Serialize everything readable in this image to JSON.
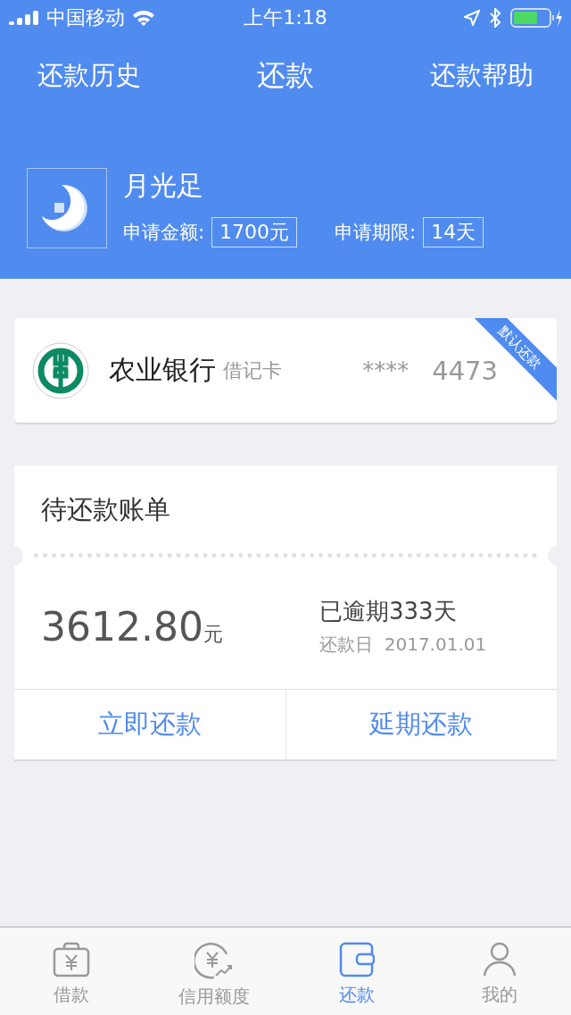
{
  "status_bar": {
    "carrier": "中国移动",
    "time": "上午1:18"
  },
  "nav": {
    "left": "还款历史",
    "title": "还款",
    "right": "还款帮助"
  },
  "product": {
    "name": "月光足",
    "amount_label": "申请金额:",
    "amount": "1700元",
    "term_label": "申请期限:",
    "term": "14天"
  },
  "bank_card": {
    "bank": "农业银行",
    "card_type": "借记卡",
    "mask": "****",
    "last4": "4473",
    "ribbon": "默认还款"
  },
  "bill": {
    "title": "待还款账单",
    "amount": "3612.80",
    "unit": "元",
    "overdue": "已逾期333天",
    "due_label": "还款日",
    "due_date": "2017.01.01",
    "actions": [
      "立即还款",
      "延期还款"
    ]
  },
  "tabs": [
    {
      "kind": "loan",
      "label": "借款",
      "selected": false
    },
    {
      "kind": "credit",
      "label": "信用额度",
      "selected": false
    },
    {
      "kind": "repay",
      "label": "还款",
      "selected": true
    },
    {
      "kind": "me",
      "label": "我的",
      "selected": false
    }
  ]
}
